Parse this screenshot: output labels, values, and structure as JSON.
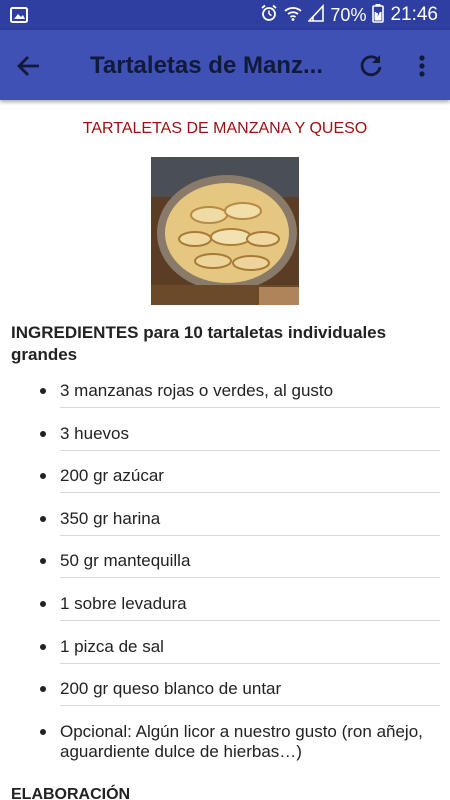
{
  "status_bar": {
    "battery": "70%",
    "time": "21:46",
    "icons": [
      "image-icon",
      "alarm-icon",
      "wifi-icon",
      "signal-icon",
      "battery-icon"
    ]
  },
  "app_bar": {
    "title": "Tartaletas de Manz...",
    "icons": [
      "back-arrow-icon",
      "refresh-icon",
      "more-vert-icon"
    ],
    "colors": {
      "background": "#3f51b5",
      "status": "#2e3ea1"
    }
  },
  "recipe": {
    "title": "TARTALETAS DE MANZANA Y QUESO",
    "ingredients_heading": "INGREDIENTES para 10 tartaletas individuales grandes",
    "ingredients": [
      "3 manzanas rojas o verdes, al gusto",
      "3 huevos",
      "200 gr azúcar",
      "350 gr harina",
      "50 gr mantequilla",
      "1 sobre levadura",
      "1 pizca de sal",
      "200 gr queso blanco de untar",
      "Opcional: Algún licor a nuestro gusto (ron añejo, aguardiente dulce de hierbas…)"
    ],
    "elaboration_heading": "ELABORACIÓN",
    "title_color": "#9c0f0f"
  }
}
